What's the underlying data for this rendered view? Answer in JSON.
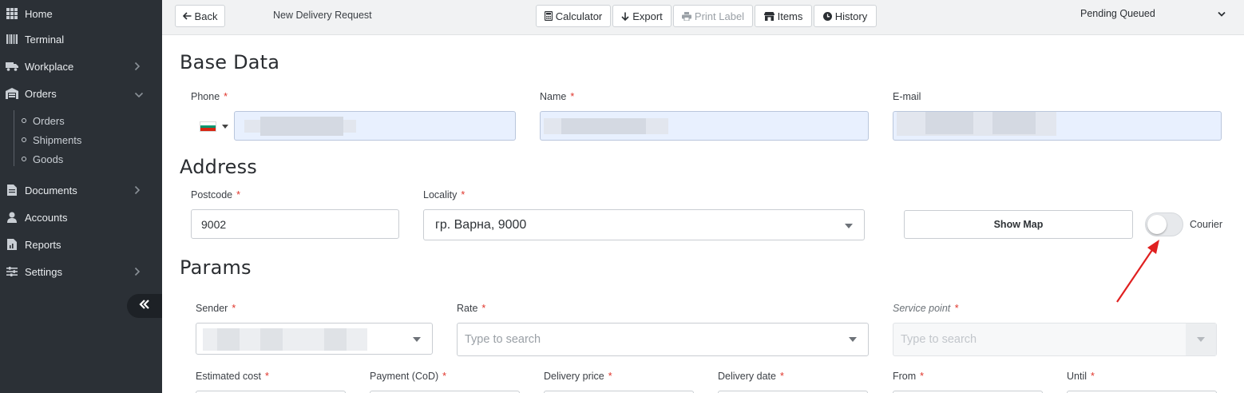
{
  "sidebar": {
    "items": [
      {
        "label": "Home",
        "icon": "grid-icon"
      },
      {
        "label": "Terminal",
        "icon": "barcode-icon"
      },
      {
        "label": "Workplace",
        "icon": "truck-icon"
      },
      {
        "label": "Orders",
        "icon": "warehouse-icon"
      },
      {
        "label": "Documents",
        "icon": "document-icon"
      },
      {
        "label": "Accounts",
        "icon": "user-icon"
      },
      {
        "label": "Reports",
        "icon": "report-icon"
      },
      {
        "label": "Settings",
        "icon": "sliders-icon"
      }
    ],
    "orders_sub": [
      "Orders",
      "Shipments",
      "Goods"
    ],
    "collapse_icon": "double-chevron-left-icon"
  },
  "toolbar": {
    "back_label": "Back",
    "page_name": "New Delivery Request",
    "calculator_label": "Calculator",
    "export_label": "Export",
    "print_label": "Print Label",
    "items_label": "Items",
    "history_label": "History",
    "status_value": "Pending Queued"
  },
  "base_data": {
    "title": "Base Data",
    "phone_label": "Phone",
    "name_label": "Name",
    "email_label": "E-mail"
  },
  "address": {
    "title": "Address",
    "postcode_label": "Postcode",
    "postcode_value": "9002",
    "locality_label": "Locality",
    "locality_value": "гр. Варна, 9000",
    "show_map_label": "Show Map",
    "courier_label": "Courier",
    "courier_enabled": false
  },
  "params": {
    "title": "Params",
    "sender_label": "Sender",
    "rate_label": "Rate",
    "rate_placeholder": "Type to search",
    "service_point_label": "Service point",
    "service_point_placeholder": "Type to search",
    "estimated_cost_label": "Estimated cost",
    "payment_label": "Payment (CoD)",
    "delivery_price_label": "Delivery price",
    "delivery_date_label": "Delivery date",
    "from_label": "From",
    "until_label": "Until"
  },
  "colors": {
    "sidebar_bg": "#2b3036",
    "required": "#e0352b",
    "annotation_arrow": "#e02020",
    "autofill_bg": "#e8f0fe"
  }
}
